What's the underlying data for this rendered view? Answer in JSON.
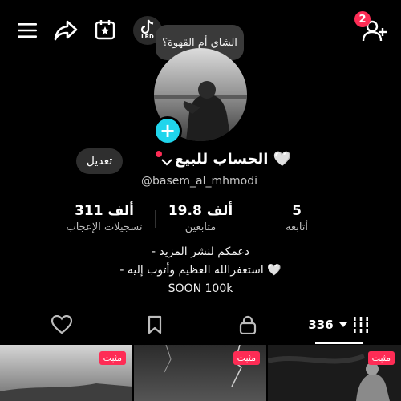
{
  "header": {
    "notifications_count": "2",
    "app_badge": "LRD",
    "icons": [
      "menu-icon",
      "share-icon",
      "calendar-star-icon",
      "tiktok-icon",
      "add-friend-icon"
    ]
  },
  "profile": {
    "status_bubble": "الشاي أم القهوة؟",
    "edit_label": "تعديل",
    "display_name": "الحساب للبيع 🤍",
    "username": "@basem_al_mhmodi"
  },
  "stats": [
    {
      "value": "311 ألف",
      "label": "تسجيلات الإعجاب"
    },
    {
      "value": "19.8 ألف",
      "label": "متابعين"
    },
    {
      "value": "5",
      "label": "أتابعه"
    }
  ],
  "bio": {
    "line1": "- دعمكم لنشر المزيد",
    "line2": "- استغفرالله العظيم وأتوب إليه 🤍",
    "line3": "SOON 100k"
  },
  "tabs": {
    "videos_count": "336"
  },
  "videos": [
    {
      "pinned_label": "مثبت"
    },
    {
      "pinned_label": "مثبت"
    },
    {
      "pinned_label": "مثبت"
    }
  ],
  "colors": {
    "accent": "#fe2c55",
    "plus": "#20d5ec",
    "background": "#000000"
  }
}
